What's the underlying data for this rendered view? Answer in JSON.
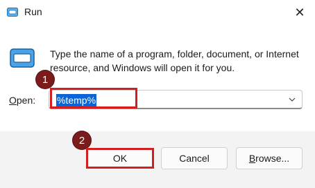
{
  "window": {
    "title": "Run",
    "close_glyph": "✕"
  },
  "description": "Type the name of a program, folder, document, or Internet resource, and Windows will open it for you.",
  "open": {
    "label_underlined": "O",
    "label_rest": "pen:",
    "value": "%temp%"
  },
  "markers": {
    "step1": "1",
    "step2": "2",
    "color": "#7a1c1c"
  },
  "buttons": {
    "ok": "OK",
    "cancel": "Cancel",
    "browse_underlined": "B",
    "browse_rest": "rowse..."
  },
  "colors": {
    "highlight": "#d11f1f",
    "selection": "#0a64d6",
    "footer_bg": "#f3f3f3"
  },
  "icons": [
    "run-icon",
    "close-icon",
    "chevron-down-icon"
  ]
}
